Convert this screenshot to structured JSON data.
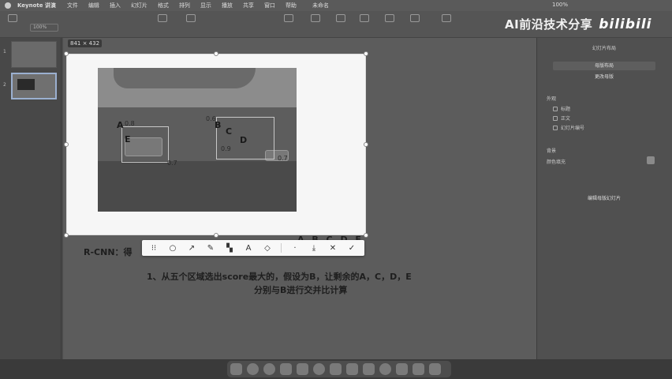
{
  "menubar": {
    "app_name": "Keynote 讲演",
    "items": [
      "文件",
      "编辑",
      "插入",
      "幻灯片",
      "格式",
      "排列",
      "显示",
      "播放",
      "共享",
      "窗口",
      "帮助"
    ],
    "document_title": "未命名",
    "battery": "100%"
  },
  "toolbar": {
    "zoom": "100%"
  },
  "watermark": {
    "text": "AI前沿技术分享",
    "logo": "bilibili"
  },
  "selection": {
    "size_label": "841 × 432"
  },
  "photo": {
    "labels": [
      "A",
      "E",
      "B",
      "C",
      "D"
    ],
    "scores": [
      "0.8",
      "0.6",
      "0.7",
      "0.9",
      "0.7"
    ]
  },
  "slide": {
    "rcnn": "R-CNN：得",
    "letters": "A B C D E",
    "line1": "1、从五个区域选出score最大的，假设为B，让剩余的A，C，D，E",
    "line2": "分别与B进行交并比计算"
  },
  "inspector": {
    "tab": "幻灯片布局",
    "master_button": "母版布局",
    "change_master": "更改母版",
    "appearance": "外观",
    "title": "标题",
    "body": "正文",
    "slide_number": "幻灯片编号",
    "background": "背景",
    "fill": "颜色填充",
    "edit_master": "编辑母版幻灯片"
  }
}
